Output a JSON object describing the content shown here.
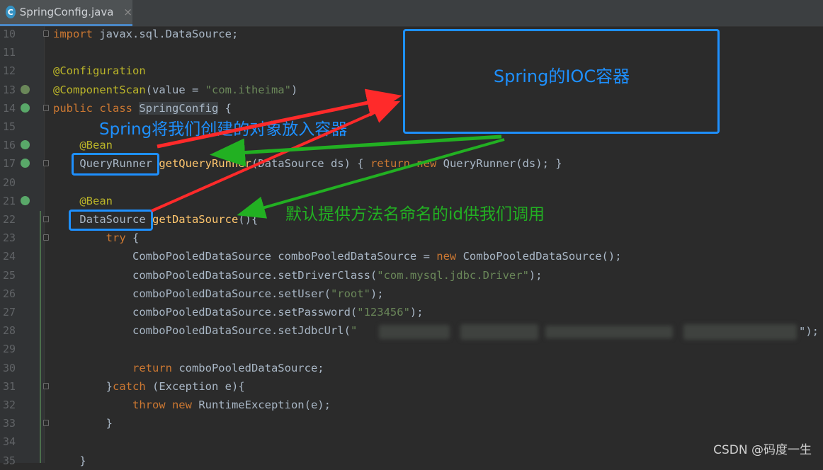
{
  "tab": {
    "icon_letter": "C",
    "filename": "SpringConfig.java",
    "close": "×"
  },
  "lines": [
    {
      "n": "10",
      "tokens": [
        {
          "t": "import ",
          "c": "kw"
        },
        {
          "t": "javax.sql.DataSource;",
          "c": ""
        }
      ]
    },
    {
      "n": "11",
      "tokens": []
    },
    {
      "n": "12",
      "tokens": [
        {
          "t": "@Configuration",
          "c": "an"
        }
      ]
    },
    {
      "n": "13",
      "tokens": [
        {
          "t": "@ComponentScan",
          "c": "an"
        },
        {
          "t": "(value = ",
          "c": ""
        },
        {
          "t": "\"com.itheima\"",
          "c": "st"
        },
        {
          "t": ")",
          "c": ""
        }
      ]
    },
    {
      "n": "14",
      "tokens": [
        {
          "t": "public class ",
          "c": "kw"
        },
        {
          "t": "SpringConfig",
          "c": "hl"
        },
        {
          "t": " {",
          "c": ""
        }
      ]
    },
    {
      "n": "15",
      "tokens": []
    },
    {
      "n": "16",
      "tokens": [
        {
          "t": "    @Bean",
          "c": "an"
        }
      ]
    },
    {
      "n": "17",
      "tokens": [
        {
          "t": "    QueryRunner ",
          "c": ""
        },
        {
          "t": "getQueryRunner",
          "c": "fn"
        },
        {
          "t": "(DataSource ds) { ",
          "c": ""
        },
        {
          "t": "return new ",
          "c": "kw"
        },
        {
          "t": "QueryRunner(ds); }",
          "c": ""
        }
      ]
    },
    {
      "n": "20",
      "tokens": []
    },
    {
      "n": "21",
      "tokens": [
        {
          "t": "    @Bean",
          "c": "an"
        }
      ]
    },
    {
      "n": "22",
      "tokens": [
        {
          "t": "    DataSource ",
          "c": ""
        },
        {
          "t": "getDataSource",
          "c": "fn"
        },
        {
          "t": "(){",
          "c": ""
        }
      ]
    },
    {
      "n": "23",
      "tokens": [
        {
          "t": "        try ",
          "c": "kw"
        },
        {
          "t": "{",
          "c": ""
        }
      ]
    },
    {
      "n": "24",
      "tokens": [
        {
          "t": "            ComboPooledDataSource comboPooledDataSource = ",
          "c": ""
        },
        {
          "t": "new ",
          "c": "kw"
        },
        {
          "t": "ComboPooledDataSource();",
          "c": ""
        }
      ]
    },
    {
      "n": "25",
      "tokens": [
        {
          "t": "            comboPooledDataSource.setDriverClass(",
          "c": ""
        },
        {
          "t": "\"com.mysql.jdbc.Driver\"",
          "c": "st"
        },
        {
          "t": ");",
          "c": ""
        }
      ]
    },
    {
      "n": "26",
      "tokens": [
        {
          "t": "            comboPooledDataSource.setUser(",
          "c": ""
        },
        {
          "t": "\"root\"",
          "c": "st"
        },
        {
          "t": ");",
          "c": ""
        }
      ]
    },
    {
      "n": "27",
      "tokens": [
        {
          "t": "            comboPooledDataSource.setPassword(",
          "c": ""
        },
        {
          "t": "\"123456\"",
          "c": "st"
        },
        {
          "t": ");",
          "c": ""
        }
      ]
    },
    {
      "n": "28",
      "tokens": [
        {
          "t": "            comboPooledDataSource.setJdbcUrl(",
          "c": ""
        },
        {
          "t": "\"",
          "c": "st"
        }
      ]
    },
    {
      "n": "29",
      "tokens": []
    },
    {
      "n": "30",
      "tokens": [
        {
          "t": "            return ",
          "c": "kw"
        },
        {
          "t": "comboPooledDataSource;",
          "c": ""
        }
      ]
    },
    {
      "n": "31",
      "tokens": [
        {
          "t": "        }",
          "c": ""
        },
        {
          "t": "catch ",
          "c": "kw"
        },
        {
          "t": "(Exception e){",
          "c": ""
        }
      ]
    },
    {
      "n": "32",
      "tokens": [
        {
          "t": "            throw new ",
          "c": "kw"
        },
        {
          "t": "RuntimeException(e);",
          "c": ""
        }
      ]
    },
    {
      "n": "33",
      "tokens": [
        {
          "t": "        }",
          "c": ""
        }
      ]
    },
    {
      "n": "34",
      "tokens": []
    },
    {
      "n": "35",
      "tokens": [
        {
          "t": "    }",
          "c": ""
        }
      ]
    }
  ],
  "line28_tail": "\");",
  "annotations": {
    "ioc_container": "Spring的IOC容器",
    "put_into_container": "Spring将我们创建的对象放入容器",
    "default_id": "默认提供方法名命名的id供我们调用"
  },
  "colors": {
    "callout_blue": "#1e90ff",
    "arrow_red": "#ff2a2a",
    "arrow_green": "#22b022"
  },
  "watermark": "CSDN @码度一生"
}
